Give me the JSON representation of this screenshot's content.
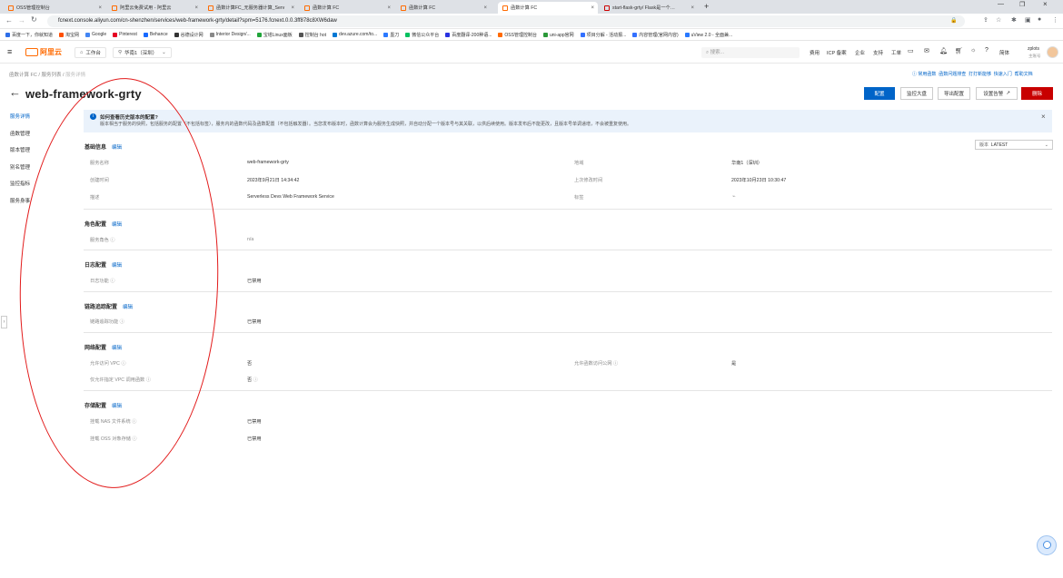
{
  "browser": {
    "tabs": [
      {
        "label": "OSS管理控制台",
        "active": false
      },
      {
        "label": "阿里云免费试用 - 阿里云",
        "active": false
      },
      {
        "label": "函数计算FC_无服务器计算_Serv",
        "active": false
      },
      {
        "label": "函数计算 FC",
        "active": false
      },
      {
        "label": "函数计算 FC",
        "active": false
      },
      {
        "label": "函数计算 FC",
        "active": true
      },
      {
        "label": "start-flask-grty/ Flask是一个…",
        "active": false
      }
    ],
    "new_tab": "+",
    "url": "fcnext.console.aliyun.com/cn-shenzhen/services/web-framework-grty/detail?spm=5176.fcnext.0.0.3ff878c8XW6daw",
    "bookmarks": [
      "百度一下，你就知道",
      "淘宝网",
      "Google",
      "Pinterest",
      "Behance",
      "谷德设计网",
      "Interior Design/...",
      "宝塔Linux面板",
      "控制台 hot",
      "dev.azure.com/to...",
      "墨刀",
      "微信公众平台",
      "百度翻译-200种语...",
      "OSS管理控制台",
      "uni-app官网",
      "项目分解 - 活动报...",
      "内容管理(官网内容)",
      "uView 2.0 - 全面兼..."
    ]
  },
  "topnav": {
    "logo": "阿里云",
    "workbench": "工作台",
    "region": "华南1（深圳）",
    "search_placeholder": "搜索...",
    "links": [
      "费用",
      "ICP 备案",
      "企业",
      "支持",
      "工单"
    ],
    "lang": "简体",
    "user": "zplots",
    "user_sub": "主账号"
  },
  "breadcrumb": [
    "函数计算 FC",
    "服务列表",
    "服务详情"
  ],
  "quicklinks": [
    "常用函数",
    "函数问题排查",
    "打打新能够",
    "快速入门",
    "帮助文档"
  ],
  "page_title": "web-framework-grty",
  "actions": {
    "config": "配置",
    "monitor": "监控大盘",
    "export": "导出配置",
    "alarm": "设置告警",
    "delete": "删除"
  },
  "sidebar": [
    "服务详情",
    "函数管理",
    "版本管理",
    "别名管理",
    "监控指标",
    "服务身事"
  ],
  "notice": {
    "title": "如何查看历史版本的配置?",
    "body": "版本相当于服务的快照，包括服务的配置（不包括标签），服务内的函数代码及函数配置（不包括触发器）。当您发布版本时，函数计算会为服务生成快照，并自动分配一个版本号与其关联，以供后续使用。版本发布后不能更改，且版本号单调递增，不会被重复使用。"
  },
  "version_select": {
    "label": "版本",
    "value": "LATEST"
  },
  "basic": {
    "title": "基础信息",
    "edit": "编辑",
    "service_name_label": "服务名称",
    "service_name": "web-framework-grty",
    "region_label": "地域",
    "region": "华南1（深圳）",
    "created_label": "创建时间",
    "created": "2023年9月21日 14:34:42",
    "modified_label": "上次修改时间",
    "modified": "2023年10月23日 10:30:47",
    "desc_label": "描述",
    "desc": "Serverless Devs Web Framework Service",
    "tags_label": "标签"
  },
  "role": {
    "title": "角色配置",
    "edit": "编辑",
    "label": "服务角色",
    "value": "n/a"
  },
  "log": {
    "title": "日志配置",
    "edit": "编辑",
    "label": "日志功能",
    "value": "已禁用"
  },
  "trace": {
    "title": "链路追踪配置",
    "edit": "编辑",
    "label": "链路追踪功能",
    "value": "已禁用"
  },
  "network": {
    "title": "网络配置",
    "edit": "编辑",
    "vpc_label": "允许访问 VPC",
    "vpc": "否",
    "internet_label": "允许函数访问公网",
    "internet": "是",
    "only_vpc_label": "仅允许指定 VPC 调用函数",
    "only_vpc": "否"
  },
  "storage": {
    "title": "存储配置",
    "edit": "编辑",
    "nas_label": "挂载 NAS 文件系统",
    "nas": "已禁用",
    "oss_label": "挂载 OSS 对象存储",
    "oss": "已禁用"
  },
  "colors": {
    "brand": "#ff6a00",
    "primary": "#0064c8",
    "danger": "#c80000",
    "annotation": "#e21a1a"
  }
}
